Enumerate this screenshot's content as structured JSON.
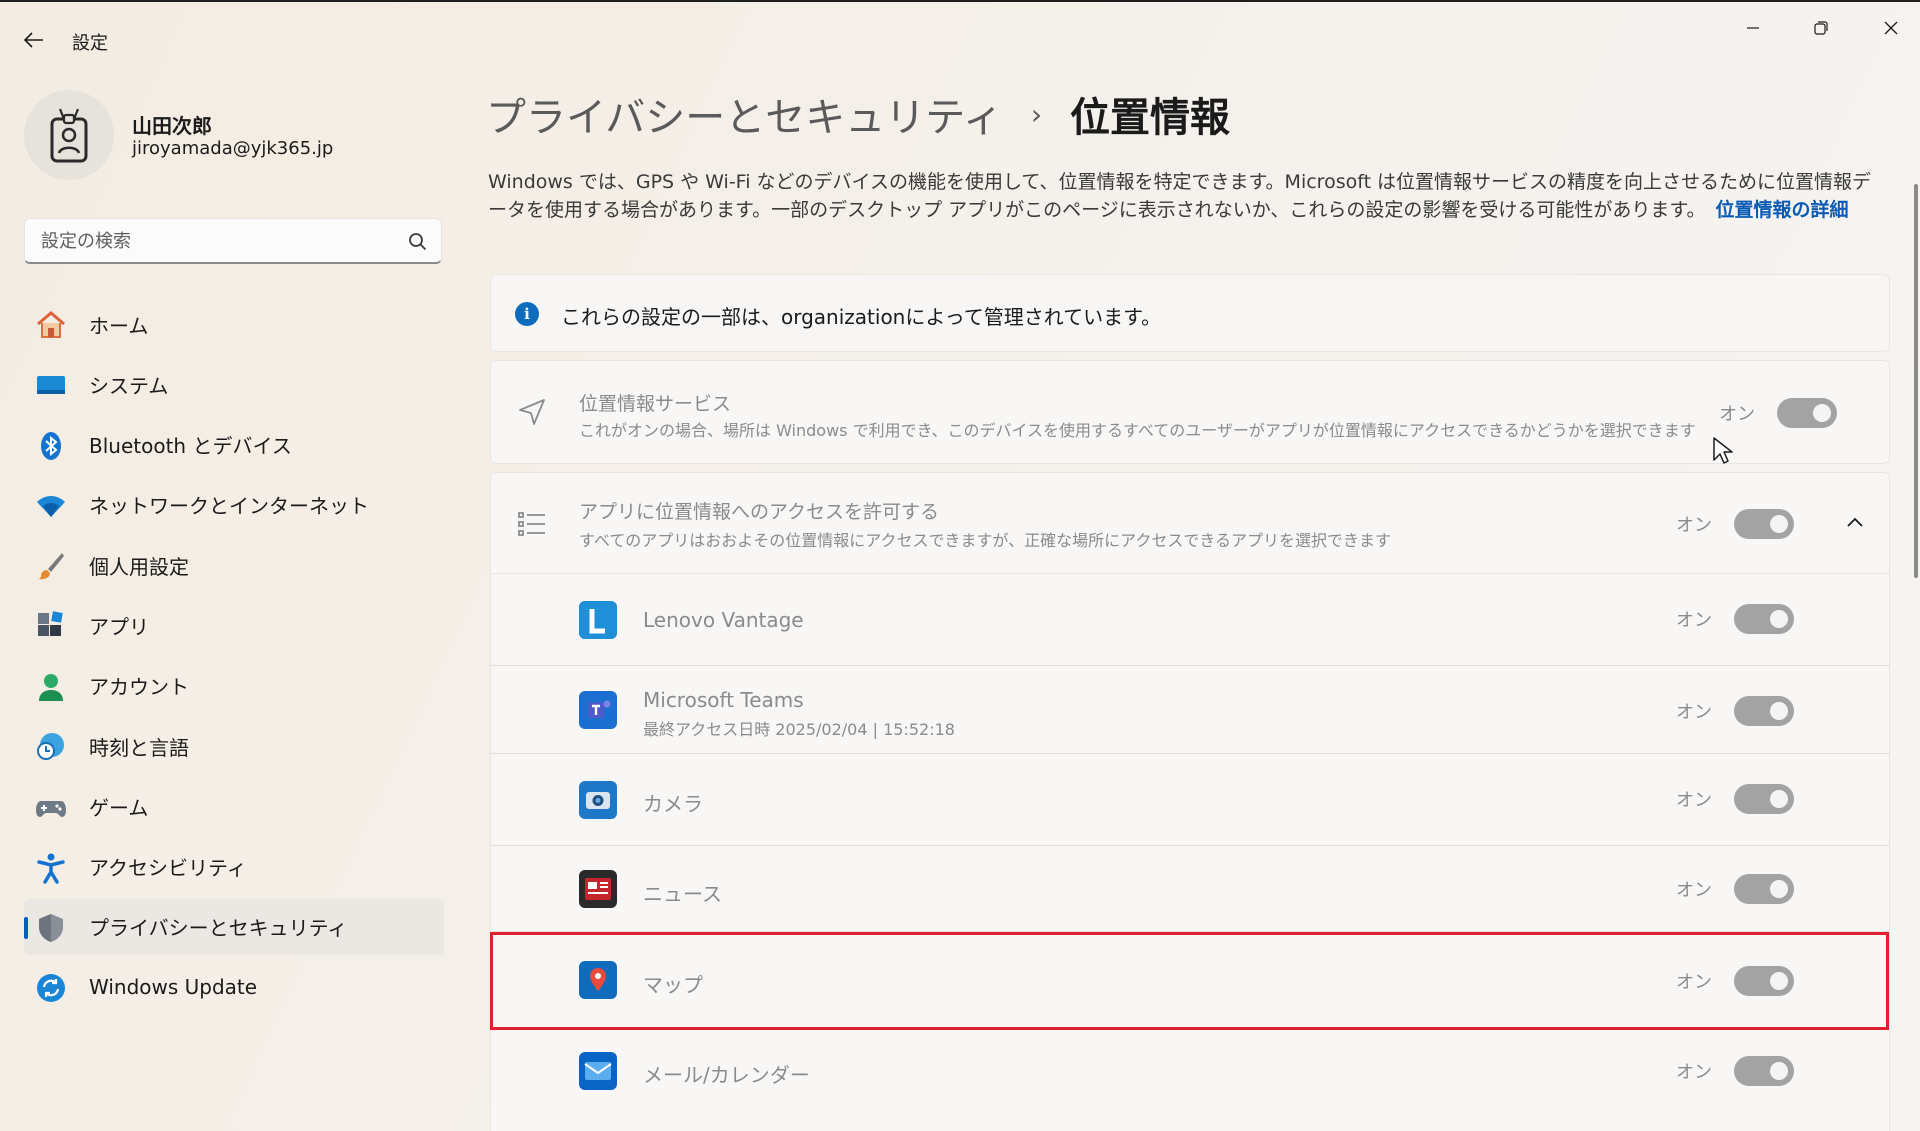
{
  "window": {
    "title": "設定"
  },
  "profile": {
    "name": "山田次郎",
    "email": "jiroyamada@yjk365.jp"
  },
  "search": {
    "placeholder": "設定の検索"
  },
  "sidebar": {
    "items": [
      {
        "label": "ホーム",
        "icon": "home-icon",
        "active": false
      },
      {
        "label": "システム",
        "icon": "system-icon",
        "active": false
      },
      {
        "label": "Bluetooth とデバイス",
        "icon": "bluetooth-icon",
        "active": false
      },
      {
        "label": "ネットワークとインターネット",
        "icon": "wifi-icon",
        "active": false
      },
      {
        "label": "個人用設定",
        "icon": "brush-icon",
        "active": false
      },
      {
        "label": "アプリ",
        "icon": "apps-icon",
        "active": false
      },
      {
        "label": "アカウント",
        "icon": "account-icon",
        "active": false
      },
      {
        "label": "時刻と言語",
        "icon": "time-language-icon",
        "active": false
      },
      {
        "label": "ゲーム",
        "icon": "gaming-icon",
        "active": false
      },
      {
        "label": "アクセシビリティ",
        "icon": "accessibility-icon",
        "active": false
      },
      {
        "label": "プライバシーとセキュリティ",
        "icon": "shield-icon",
        "active": true
      },
      {
        "label": "Windows Update",
        "icon": "windows-update-icon",
        "active": false
      }
    ]
  },
  "main": {
    "breadcrumb_parent": "プライバシーとセキュリティ",
    "breadcrumb_separator": "›",
    "breadcrumb_current": "位置情報",
    "description": "Windows では、GPS や Wi-Fi などのデバイスの機能を使用して、位置情報を特定できます。Microsoft は位置情報サービスの精度を向上させるために位置情報データを使用する場合があります。一部のデスクトップ アプリがこのページに表示されないか、これらの設定の影響を受ける可能性があります。",
    "description_link": "位置情報の詳細",
    "info_message": "これらの設定の一部は、organizationによって管理されています。",
    "location_service": {
      "title": "位置情報サービス",
      "subtitle": "これがオンの場合、場所は Windows で利用でき、このデバイスを使用するすべてのユーザーがアプリが位置情報にアクセスできるかどうかを選択できます",
      "state": "オン"
    },
    "app_access": {
      "title": "アプリに位置情報へのアクセスを許可する",
      "subtitle": "すべてのアプリはおおよその位置情報にアクセスできますが、正確な場所にアクセスできるアプリを選択できます",
      "state": "オン"
    },
    "apps": [
      {
        "name": "Lenovo Vantage",
        "subtitle": "",
        "state": "オン",
        "icon": "lenovo-vantage-icon",
        "color": "#1f8fd8"
      },
      {
        "name": "Microsoft Teams",
        "subtitle": "最終アクセス日時 2025/02/04 | 15:52:18",
        "state": "オン",
        "icon": "teams-icon",
        "color": "#5059c9"
      },
      {
        "name": "カメラ",
        "subtitle": "",
        "state": "オン",
        "icon": "camera-icon",
        "color": "#1e78c8"
      },
      {
        "name": "ニュース",
        "subtitle": "",
        "state": "オン",
        "icon": "news-icon",
        "color": "#c4262e"
      },
      {
        "name": "マップ",
        "subtitle": "",
        "state": "オン",
        "icon": "maps-icon",
        "color": "#0f6cbd"
      },
      {
        "name": "メール/カレンダー",
        "subtitle": "",
        "state": "オン",
        "icon": "mail-icon",
        "color": "#0a64c6"
      }
    ]
  },
  "colors": {
    "accent": "#005fb8",
    "link": "#0a5bb5",
    "highlight": "#e0202e",
    "toggle_disabled": "#a3a3a3"
  }
}
